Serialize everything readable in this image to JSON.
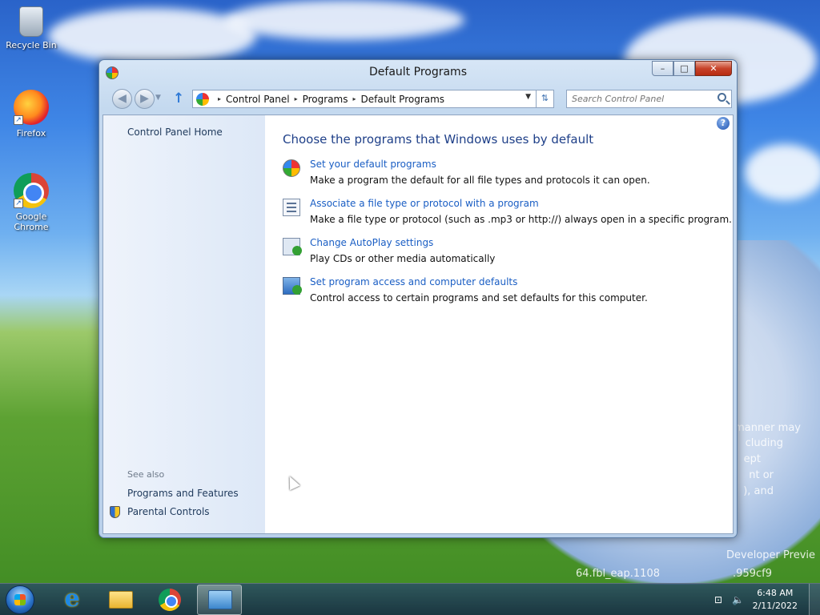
{
  "desktop": {
    "icons": [
      {
        "label": "Recycle Bin",
        "icon": "recycle-bin-icon"
      },
      {
        "label": "Firefox",
        "icon": "firefox-icon"
      },
      {
        "label": "Google Chrome",
        "icon": "chrome-icon"
      }
    ],
    "watermark_lines": [
      "manner may",
      "cluding",
      "ept",
      "nt or",
      "), and",
      "Developer Previe",
      "64.fbl_eap.1108",
      ".959cf9"
    ]
  },
  "window": {
    "title": "Default Programs",
    "caption_buttons": {
      "minimize": "–",
      "maximize": "□",
      "close": "✕"
    },
    "address": {
      "crumbs": [
        "Control Panel",
        "Programs",
        "Default Programs"
      ],
      "separator": "▸"
    },
    "search": {
      "placeholder": "Search Control Panel"
    },
    "left_pane": {
      "home_link": "Control Panel Home",
      "see_also_heading": "See also",
      "see_also_links": [
        "Programs and Features",
        "Parental Controls"
      ]
    },
    "main": {
      "heading": "Choose the programs that Windows uses by default",
      "help_glyph": "?",
      "tasks": [
        {
          "link": "Set your default programs",
          "description": "Make a program the default for all file types and protocols it can open.",
          "icon": "default-programs-icon"
        },
        {
          "link": "Associate a file type or protocol with a program",
          "description": "Make a file type or protocol (such as .mp3 or http://) always open in a specific program.",
          "icon": "file-association-icon"
        },
        {
          "link": "Change AutoPlay settings",
          "description": "Play CDs or other media automatically",
          "icon": "autoplay-icon"
        },
        {
          "link": "Set program access and computer defaults",
          "description": "Control access to certain programs and set defaults for this computer.",
          "icon": "program-access-icon"
        }
      ]
    }
  },
  "taskbar": {
    "pinned": [
      {
        "name": "Internet Explorer",
        "icon": "internet-explorer-icon"
      },
      {
        "name": "Windows Explorer",
        "icon": "folder-icon"
      },
      {
        "name": "Google Chrome",
        "icon": "chrome-icon"
      },
      {
        "name": "Control Panel",
        "icon": "control-panel-icon",
        "active": true
      }
    ],
    "clock": {
      "time": "6:48 AM",
      "date": "2/11/2022"
    }
  }
}
